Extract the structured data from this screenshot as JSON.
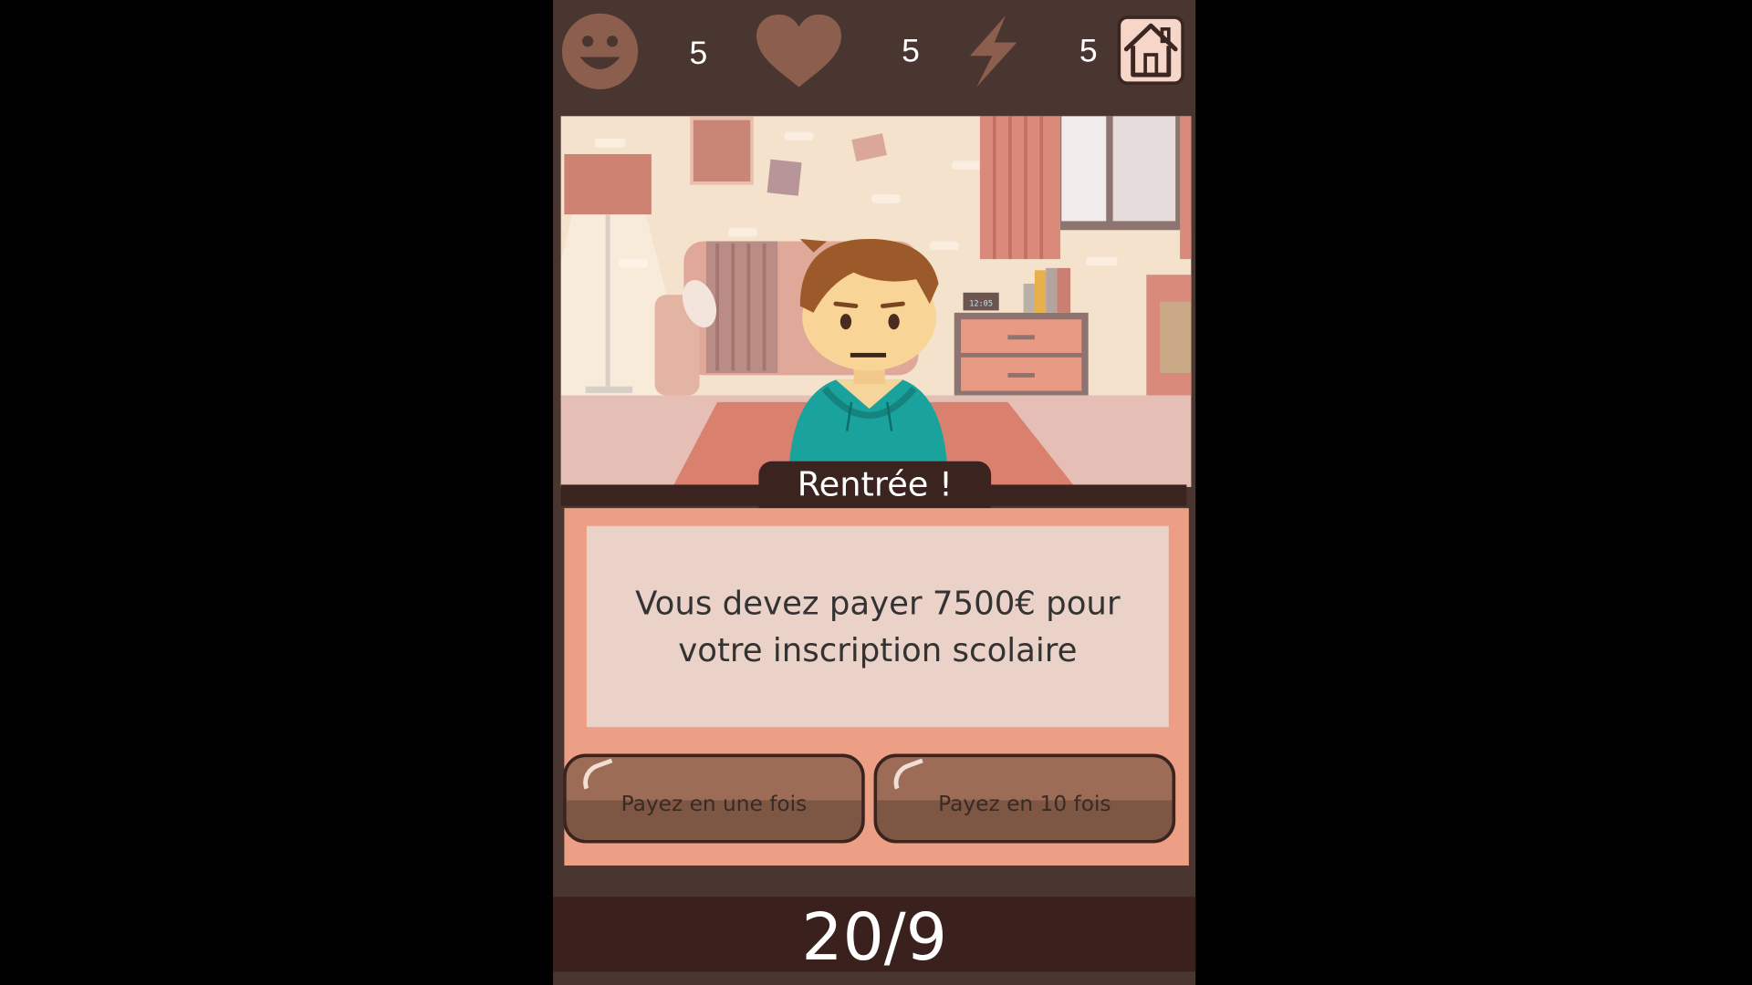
{
  "stats": {
    "happiness": {
      "icon": "smiley-face-icon",
      "value": "5"
    },
    "health": {
      "icon": "heart-icon",
      "value": "5"
    },
    "energy": {
      "icon": "lightning-bolt-icon",
      "value": "5"
    }
  },
  "home_button": {
    "icon": "home-icon"
  },
  "event": {
    "title": "Rentrée !",
    "message": "Vous devez payer 7500€ pour votre inscription scolaire"
  },
  "choices": [
    {
      "label": "Payez en une fois"
    },
    {
      "label": "Payez en 10 fois"
    }
  ],
  "scene": {
    "clock_text": "12:05"
  },
  "date": "20/9",
  "colors": {
    "background": "#4a3630",
    "dark_band": "#3b241f",
    "card": "#ec9f84",
    "message_box": "#ead2c8",
    "button": "#8c604d",
    "icon": "#8b5e4d"
  }
}
